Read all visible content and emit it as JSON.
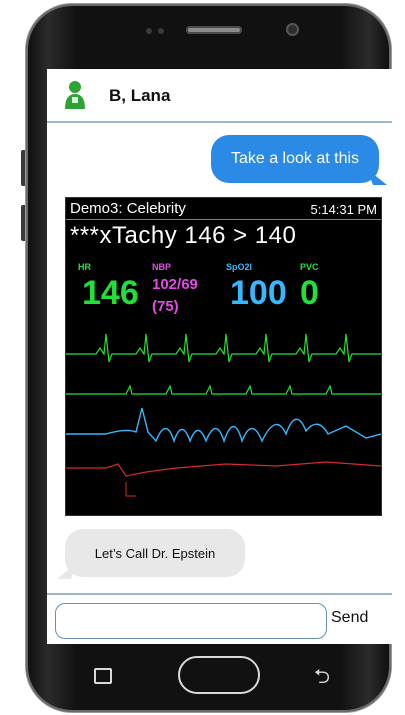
{
  "contact": {
    "name": "B, Lana"
  },
  "messages": {
    "outgoing_text": "Take a look at this",
    "incoming_text": "Let’s Call Dr. Epstein"
  },
  "monitor": {
    "title": "Demo3: Celebrity",
    "time": "5:14:31 PM",
    "alarm": "***xTachy 146 > 140",
    "hr_label": "HR",
    "hr_value": "146",
    "nbp_label": "NBP",
    "nbp_value": "102/69",
    "nbp_mean": "(75)",
    "spo2_label": "SpO2l",
    "spo2_value": "100",
    "pvc_label": "PVC",
    "pvc_value": "0",
    "colors": {
      "hr": "#22e03a",
      "nbp": "#e24be6",
      "spo2": "#37b7ff",
      "pvc": "#22e03a"
    }
  },
  "composer": {
    "placeholder": "",
    "send_label": "Send"
  },
  "icons": [
    "avatar-icon",
    "recent-apps-icon",
    "home-button",
    "back-icon"
  ]
}
